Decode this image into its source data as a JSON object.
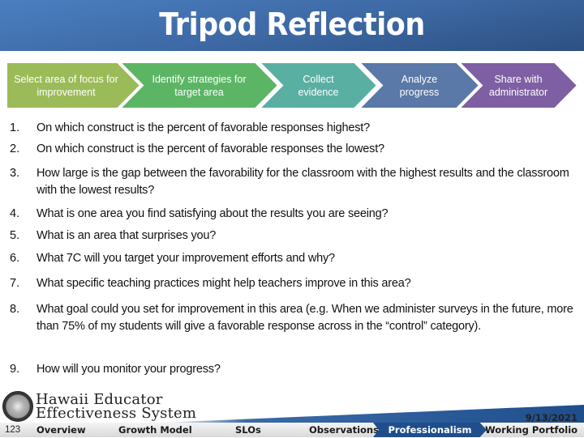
{
  "title": "Tripod Reflection",
  "process_steps": [
    {
      "label": "Select area of focus for\nimprovement",
      "color": "#9bbb59"
    },
    {
      "label": "Identify strategies for\ntarget area",
      "color": "#5cb565"
    },
    {
      "label": "Collect\nevidence",
      "color": "#5aafa3"
    },
    {
      "label": "Analyze\nprogress",
      "color": "#5a78a8"
    },
    {
      "label": "Share with\nadministrator",
      "color": "#7e5fa3"
    }
  ],
  "questions": [
    {
      "num": "1.",
      "text": "On which construct is the percent of favorable responses highest?"
    },
    {
      "num": "2.",
      "text": "On which construct is the percent of favorable responses the lowest?"
    },
    {
      "num": "3.",
      "text": "How large is the gap between the favorability for the classroom with the highest results and the classroom with the lowest results?"
    },
    {
      "num": "4.",
      "text": "What is one area you find satisfying about the results you are seeing?"
    },
    {
      "num": "5.",
      "text": "What is an area that surprises you?"
    },
    {
      "num": "6.",
      "text": "What 7C will you target your improvement efforts and why?"
    },
    {
      "num": "7.",
      "text": "What specific teaching practices might help teachers improve in this area?"
    },
    {
      "num": "8.",
      "text": "What goal could you set for improvement in this area (e.g. When we administer surveys in the future, more than 75% of my students will give a favorable response across in the “control” category)."
    },
    {
      "num": "9.",
      "text": "How will you monitor your progress?"
    }
  ],
  "footer": {
    "logo_line1": "Hawaii Educator",
    "logo_line2": "Effectiveness System",
    "page_number": "123",
    "date": "9/13/2021",
    "nav": [
      {
        "label": "Overview",
        "active": false
      },
      {
        "label": "Growth Model",
        "active": false
      },
      {
        "label": "SLOs",
        "active": false
      },
      {
        "label": "Observations",
        "active": false
      },
      {
        "label": "Professionalism",
        "active": true
      },
      {
        "label": "Working Portfolio",
        "active": false
      }
    ],
    "active_color": "#1f4e8c"
  }
}
